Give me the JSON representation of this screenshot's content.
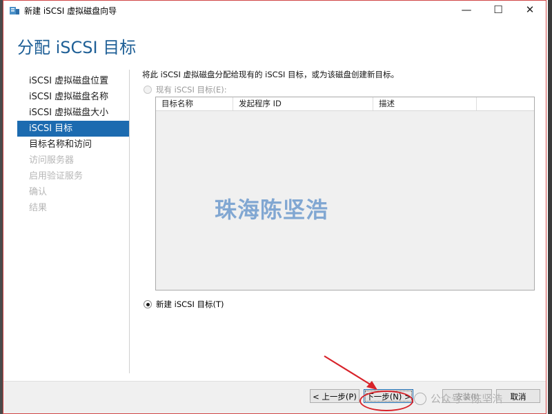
{
  "window": {
    "title": "新建 iSCSI 虚拟磁盘向导",
    "controls": {
      "minimize": "—",
      "maximize": "☐",
      "close": "✕"
    }
  },
  "page_title": "分配 iSCSI 目标",
  "nav": [
    {
      "label": "iSCSI 虚拟磁盘位置",
      "state": "normal"
    },
    {
      "label": "iSCSI 虚拟磁盘名称",
      "state": "normal"
    },
    {
      "label": "iSCSI 虚拟磁盘大小",
      "state": "normal"
    },
    {
      "label": "iSCSI 目标",
      "state": "selected"
    },
    {
      "label": "目标名称和访问",
      "state": "normal"
    },
    {
      "label": "访问服务器",
      "state": "disabled"
    },
    {
      "label": "启用验证服务",
      "state": "disabled"
    },
    {
      "label": "确认",
      "state": "disabled"
    },
    {
      "label": "结果",
      "state": "disabled"
    }
  ],
  "description": "将此 iSCSI 虚拟磁盘分配给现有的 iSCSI 目标，或为该磁盘创建新目标。",
  "options": {
    "existing": {
      "label": "现有 iSCSI 目标(E):",
      "checked": false,
      "enabled": false
    },
    "new": {
      "label": "新建 iSCSI 目标(T)",
      "checked": true,
      "enabled": true
    }
  },
  "table": {
    "columns": [
      "目标名称",
      "发起程序 ID",
      "描述"
    ],
    "rows": []
  },
  "watermark_text": "珠海陈坚浩",
  "buttons": {
    "prev": "< 上一步(P)",
    "next": "下一步(N) >",
    "install": "安装(I)",
    "cancel": "取消"
  },
  "social_watermark": "公众号 · 陈坚浩",
  "colors": {
    "accent": "#1c6bb0",
    "title": "#1e5f96",
    "annotation": "#d8232a"
  }
}
